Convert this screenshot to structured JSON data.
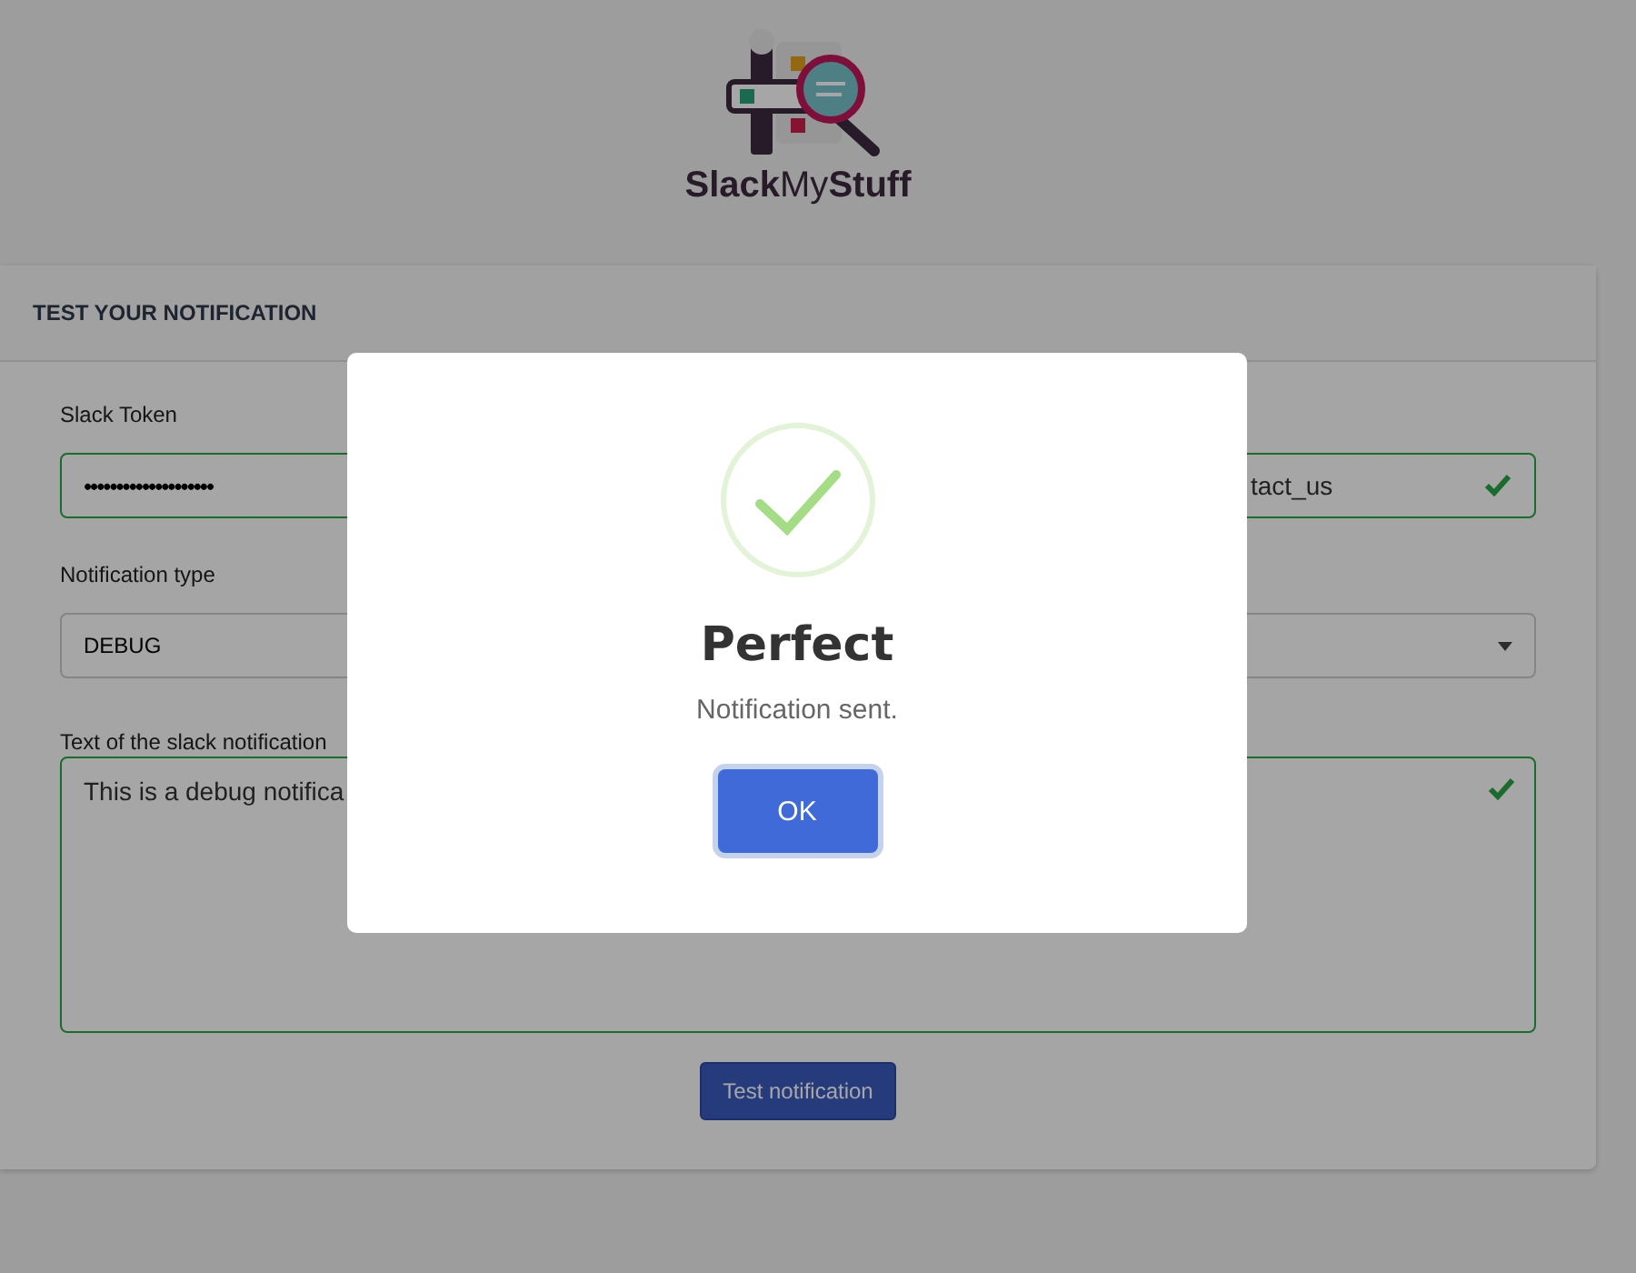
{
  "logo": {
    "text": "**Slack**My**Stuff**"
  },
  "card": {
    "title": "TEST YOUR NOTIFICATION"
  },
  "token": {
    "label": "Slack Token",
    "value": "••••••••••••••••••••",
    "valid": true
  },
  "channel": {
    "value": "tact_us",
    "valid": true
  },
  "notification_type": {
    "label": "Notification type",
    "value": "DEBUG"
  },
  "message": {
    "label": "Text of the slack notification",
    "value": "This is a debug notifica",
    "valid": true
  },
  "submit_button": "Test notification",
  "dialog": {
    "title": "Perfect",
    "text": "Notification sent.",
    "button": "OK"
  }
}
